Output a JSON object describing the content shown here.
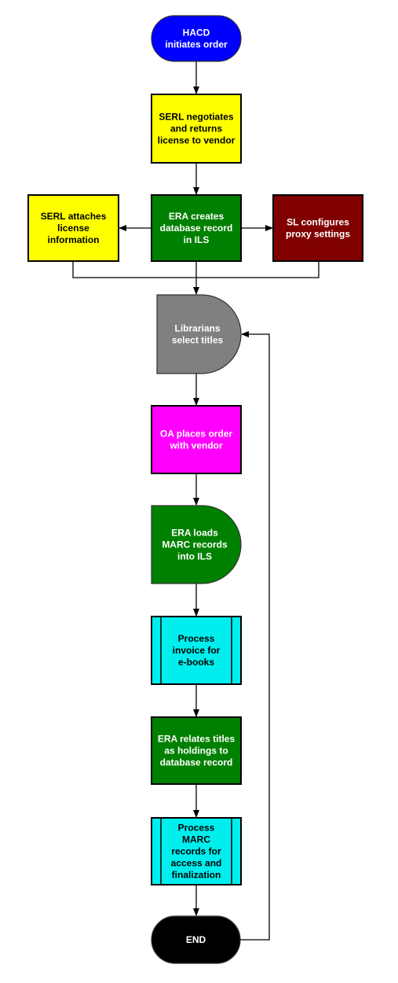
{
  "diagram": {
    "type": "flowchart",
    "nodes": [
      {
        "id": "hacd",
        "shape": "terminator",
        "fill": "#0000FF",
        "text_color": "#FFFFFF",
        "lines": [
          "HACD",
          "initiates order"
        ]
      },
      {
        "id": "serl_negotiates",
        "shape": "process",
        "fill": "#FFFF00",
        "text_color": "#000000",
        "lines": [
          "SERL negotiates",
          "and returns",
          "license to vendor"
        ]
      },
      {
        "id": "serl_attaches",
        "shape": "process",
        "fill": "#FFFF00",
        "text_color": "#000000",
        "lines": [
          "SERL attaches",
          "license",
          "information"
        ]
      },
      {
        "id": "era_creates",
        "shape": "process",
        "fill": "#008000",
        "text_color": "#FFFFFF",
        "lines": [
          "ERA creates",
          "database record",
          "in ILS"
        ]
      },
      {
        "id": "sl_configures",
        "shape": "process",
        "fill": "#800000",
        "text_color": "#FFFFFF",
        "lines": [
          "SL configures",
          "proxy settings"
        ]
      },
      {
        "id": "librarians",
        "shape": "delay",
        "fill": "#808080",
        "text_color": "#FFFFFF",
        "lines": [
          "Librarians",
          "select titles"
        ]
      },
      {
        "id": "oa_places",
        "shape": "process",
        "fill": "#FF00FF",
        "text_color": "#FFFFFF",
        "lines": [
          "OA places order",
          "with vendor"
        ]
      },
      {
        "id": "era_loads",
        "shape": "delay",
        "fill": "#008000",
        "text_color": "#FFFFFF",
        "lines": [
          "ERA loads",
          "MARC records",
          "into ILS"
        ]
      },
      {
        "id": "process_invoice",
        "shape": "predefined-process",
        "fill": "#00EEEE",
        "text_color": "#000000",
        "lines": [
          "Process",
          "invoice for",
          "e-books"
        ]
      },
      {
        "id": "era_relates",
        "shape": "process",
        "fill": "#008000",
        "text_color": "#FFFFFF",
        "lines": [
          "ERA relates titles",
          "as holdings to",
          "database record"
        ]
      },
      {
        "id": "process_marc",
        "shape": "predefined-process",
        "fill": "#00EEEE",
        "text_color": "#000000",
        "lines": [
          "Process",
          "MARC",
          "records for",
          "access and",
          "finalization"
        ]
      },
      {
        "id": "end",
        "shape": "terminator",
        "fill": "#000000",
        "text_color": "#FFFFFF",
        "lines": [
          "END"
        ]
      }
    ],
    "edges": [
      {
        "from": "hacd",
        "to": "serl_negotiates"
      },
      {
        "from": "serl_negotiates",
        "to": "era_creates"
      },
      {
        "from": "era_creates",
        "to": "serl_attaches"
      },
      {
        "from": "era_creates",
        "to": "sl_configures"
      },
      {
        "from": "era_creates",
        "to": "librarians"
      },
      {
        "from": "serl_attaches",
        "to": "librarians"
      },
      {
        "from": "sl_configures",
        "to": "librarians"
      },
      {
        "from": "librarians",
        "to": "oa_places"
      },
      {
        "from": "oa_places",
        "to": "era_loads"
      },
      {
        "from": "era_loads",
        "to": "process_invoice"
      },
      {
        "from": "process_invoice",
        "to": "era_relates"
      },
      {
        "from": "era_relates",
        "to": "process_marc"
      },
      {
        "from": "process_marc",
        "to": "end"
      },
      {
        "from": "end",
        "to": "librarians",
        "note": "loop back"
      }
    ]
  }
}
